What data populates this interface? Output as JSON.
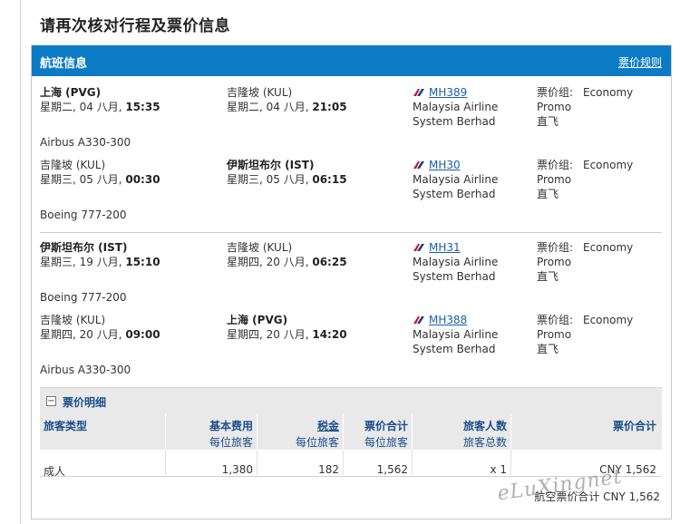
{
  "page_title": "请再次核对行程及票价信息",
  "panel": {
    "title": "航班信息",
    "rules_link": "票价规则"
  },
  "segments": [
    {
      "from_city": "上海 (PVG)",
      "from_date": "星期二, 04 八月, ",
      "from_time": "15:35",
      "to_city": "吉隆坡 (KUL)",
      "to_date": "星期二, 04 八月, ",
      "to_time": "21:05",
      "flight": "MH389",
      "airline_line1": "Malaysia Airline",
      "airline_line2": "System Berhad",
      "fare_group_label": "票价组:",
      "fare_group_value": "Economy",
      "fare_type": "Promo",
      "stops": "直飞",
      "aircraft": "Airbus A330-300"
    },
    {
      "from_city": "吉隆坡 (KUL)",
      "from_date": "星期三, 05 八月, ",
      "from_time": "00:30",
      "to_city": "伊斯坦布尔 (IST)",
      "to_date": "星期三, 05 八月, ",
      "to_time": "06:15",
      "flight": "MH30",
      "airline_line1": "Malaysia Airline",
      "airline_line2": "System Berhad",
      "fare_group_label": "票价组:",
      "fare_group_value": "Economy",
      "fare_type": "Promo",
      "stops": "直飞",
      "aircraft": "Boeing 777-200"
    },
    {
      "from_city": "伊斯坦布尔 (IST)",
      "from_date": "星期三, 19 八月, ",
      "from_time": "15:10",
      "to_city": "吉隆坡 (KUL)",
      "to_date": "星期四, 20 八月, ",
      "to_time": "06:25",
      "flight": "MH31",
      "airline_line1": "Malaysia Airline",
      "airline_line2": "System Berhad",
      "fare_group_label": "票价组:",
      "fare_group_value": "Economy",
      "fare_type": "Promo",
      "stops": "直飞",
      "aircraft": "Boeing 777-200"
    },
    {
      "from_city": "吉隆坡 (KUL)",
      "from_date": "星期四, 20 八月, ",
      "from_time": "09:00",
      "to_city": "上海 (PVG)",
      "to_date": "星期四, 20 八月, ",
      "to_time": "14:20",
      "flight": "MH388",
      "airline_line1": "Malaysia Airline",
      "airline_line2": "System Berhad",
      "fare_group_label": "票价组:",
      "fare_group_value": "Economy",
      "fare_type": "Promo",
      "stops": "直飞",
      "aircraft": "Airbus A330-300"
    }
  ],
  "fare_details": {
    "toggle_symbol": "−",
    "title": "票价明细",
    "headers": {
      "passenger_type": "旅客类型",
      "base_fare": "基本费用",
      "base_fare_sub": "每位旅客",
      "tax": "税金",
      "tax_sub": "每位旅客",
      "fare_total": "票价合计",
      "fare_total_sub": "每位旅客",
      "pax_count": "旅客人数",
      "pax_count_sub": "旅客总数",
      "grand_total": "票价合计"
    },
    "row": {
      "passenger_type": "成人",
      "base_fare": "1,380",
      "tax": "182",
      "fare_total": "1,562",
      "pax_count": "x 1",
      "grand_total": "CNY 1,562"
    },
    "total_line": "航空票价合计 CNY 1,562"
  },
  "watermark": "eLuXingnet",
  "colors": {
    "header_bg": "#0c7bc5",
    "link": "#1b5fa8",
    "table_header_text": "#1b4f8a"
  }
}
